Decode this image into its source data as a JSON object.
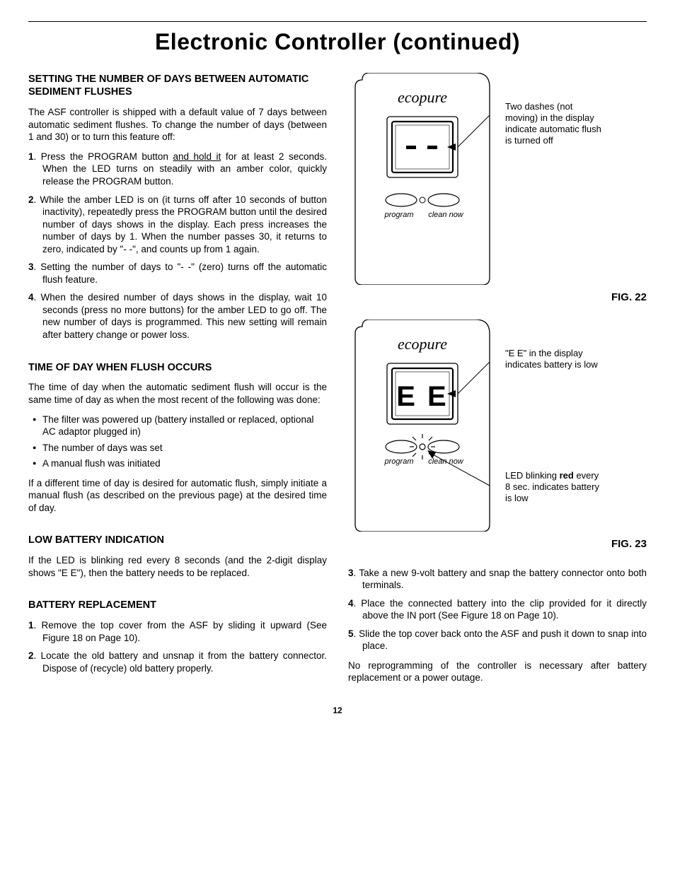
{
  "title": "Electronic Controller (continued)",
  "pageNumber": "12",
  "left": {
    "h1": "SETTING THE NUMBER OF DAYS BETWEEN AUTOMATIC SEDIMENT FLUSHES",
    "p1": "The ASF controller is shipped with a default value of 7 days between automatic sediment flushes.  To change the number of days (between 1 and 30) or to turn this feature off:",
    "li1a": "1",
    "li1b": ". Press the PROGRAM button ",
    "li1u": "and hold it",
    "li1c": " for at least 2 seconds.  When the LED turns on steadily with an amber color, quickly release the PROGRAM button.",
    "li2a": "2",
    "li2b": ". While the amber LED is on (it turns off after 10 seconds of button inactivity), repeatedly press the PROGRAM button until the desired number of days shows in the display.  Each press increases the number of days by 1.  When the number passes 30, it returns to zero, indicated by \"- -\", and counts up from 1 again.",
    "li3a": "3",
    "li3b": ". Setting the number of days to \"- -\" (zero) turns off the automatic flush feature.",
    "li4a": "4",
    "li4b": ". When the desired number of days shows in the display, wait 10 seconds (press no more buttons) for the amber LED to go off.  The new number of days is programmed.  This new setting will remain after battery change or power loss.",
    "h2": "TIME OF DAY WHEN FLUSH OCCURS",
    "p2": "The time of day when the automatic sediment flush will occur is the same time of day as when the most recent of the following was done:",
    "b1": "The filter was powered up (battery installed or replaced, optional AC adaptor plugged in)",
    "b2": "The number of days was set",
    "b3": "A manual flush was initiated",
    "p3": "If a different time of day is desired for automatic flush, simply initiate a manual flush (as described on the previous page) at the desired time of day.",
    "h3": "LOW BATTERY INDICATION",
    "p4": "If the LED is blinking red every 8 seconds (and the 2-digit display shows \"E E\"), then the battery needs to be replaced.",
    "h4": "BATTERY REPLACEMENT",
    "r1a": "1",
    "r1b": ". Remove the top cover from the ASF by sliding it upward (See Figure 18 on Page 10).",
    "r2a": "2",
    "r2b": ". Locate the old battery and unsnap it from the battery connector.  Dispose of (recycle) old battery properly."
  },
  "right": {
    "fig22": {
      "brand": "ecopure",
      "btnLeft": "program",
      "btnRight": "clean now",
      "callout": "Two dashes (not moving) in the display indicate automatic flush is turned off",
      "label": "FIG. 22"
    },
    "fig23": {
      "brand": "ecopure",
      "btnLeft": "program",
      "btnRight": "clean now",
      "display": "E E",
      "callout1": "\"E E\" in the display indicates battery is low",
      "callout2a": "LED blinking ",
      "callout2b": "red",
      "callout2c": " every 8 sec. indicates battery is low",
      "label": "FIG. 23"
    },
    "r3a": "3",
    "r3b": ". Take a new 9-volt battery and snap the battery connector onto both terminals.",
    "r4a": "4",
    "r4b": ". Place the connected battery into the clip provided for it directly above the IN port (See Figure 18 on Page 10).",
    "r5a": "5",
    "r5b": ". Slide the top cover back onto the ASF and push it down to snap into place.",
    "p5": "No reprogramming of the controller is necessary after battery replacement or a power outage."
  }
}
